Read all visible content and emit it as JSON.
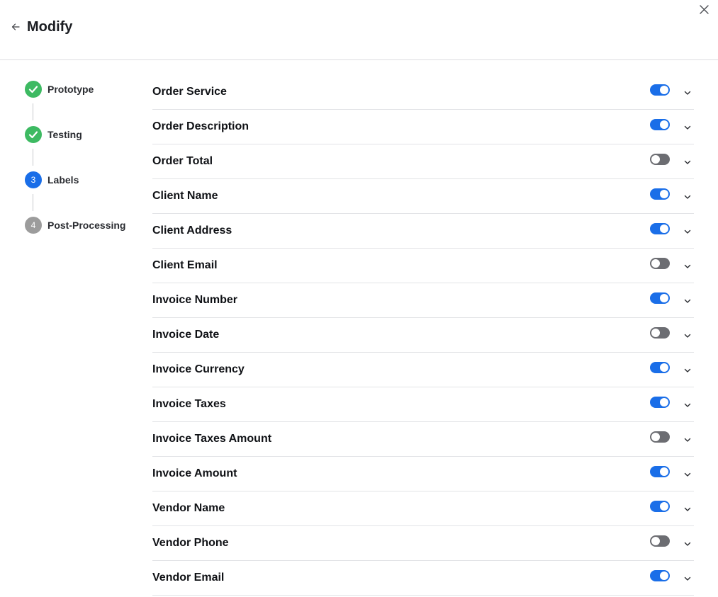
{
  "header": {
    "title": "Modify",
    "back_icon": "arrow-left-icon",
    "close_icon": "close-icon"
  },
  "steps": [
    {
      "label": "Prototype",
      "status": "done",
      "marker": ""
    },
    {
      "label": "Testing",
      "status": "done",
      "marker": ""
    },
    {
      "label": "Labels",
      "status": "active",
      "marker": "3"
    },
    {
      "label": "Post-Processing",
      "status": "pending",
      "marker": "4"
    }
  ],
  "fields": [
    {
      "label": "Order Service",
      "enabled": true
    },
    {
      "label": "Order Description",
      "enabled": true
    },
    {
      "label": "Order Total",
      "enabled": false
    },
    {
      "label": "Client Name",
      "enabled": true
    },
    {
      "label": "Client Address",
      "enabled": true
    },
    {
      "label": "Client Email",
      "enabled": false
    },
    {
      "label": "Invoice Number",
      "enabled": true
    },
    {
      "label": "Invoice Date",
      "enabled": false
    },
    {
      "label": "Invoice Currency",
      "enabled": true
    },
    {
      "label": "Invoice Taxes",
      "enabled": true
    },
    {
      "label": "Invoice Taxes Amount",
      "enabled": false
    },
    {
      "label": "Invoice Amount",
      "enabled": true
    },
    {
      "label": "Vendor Name",
      "enabled": true
    },
    {
      "label": "Vendor Phone",
      "enabled": false
    },
    {
      "label": "Vendor Email",
      "enabled": true
    }
  ],
  "colors": {
    "accent": "#1a6ee8",
    "done": "#3dba62",
    "pending": "#9c9c9c",
    "toggle_off": "#6c6d72"
  }
}
